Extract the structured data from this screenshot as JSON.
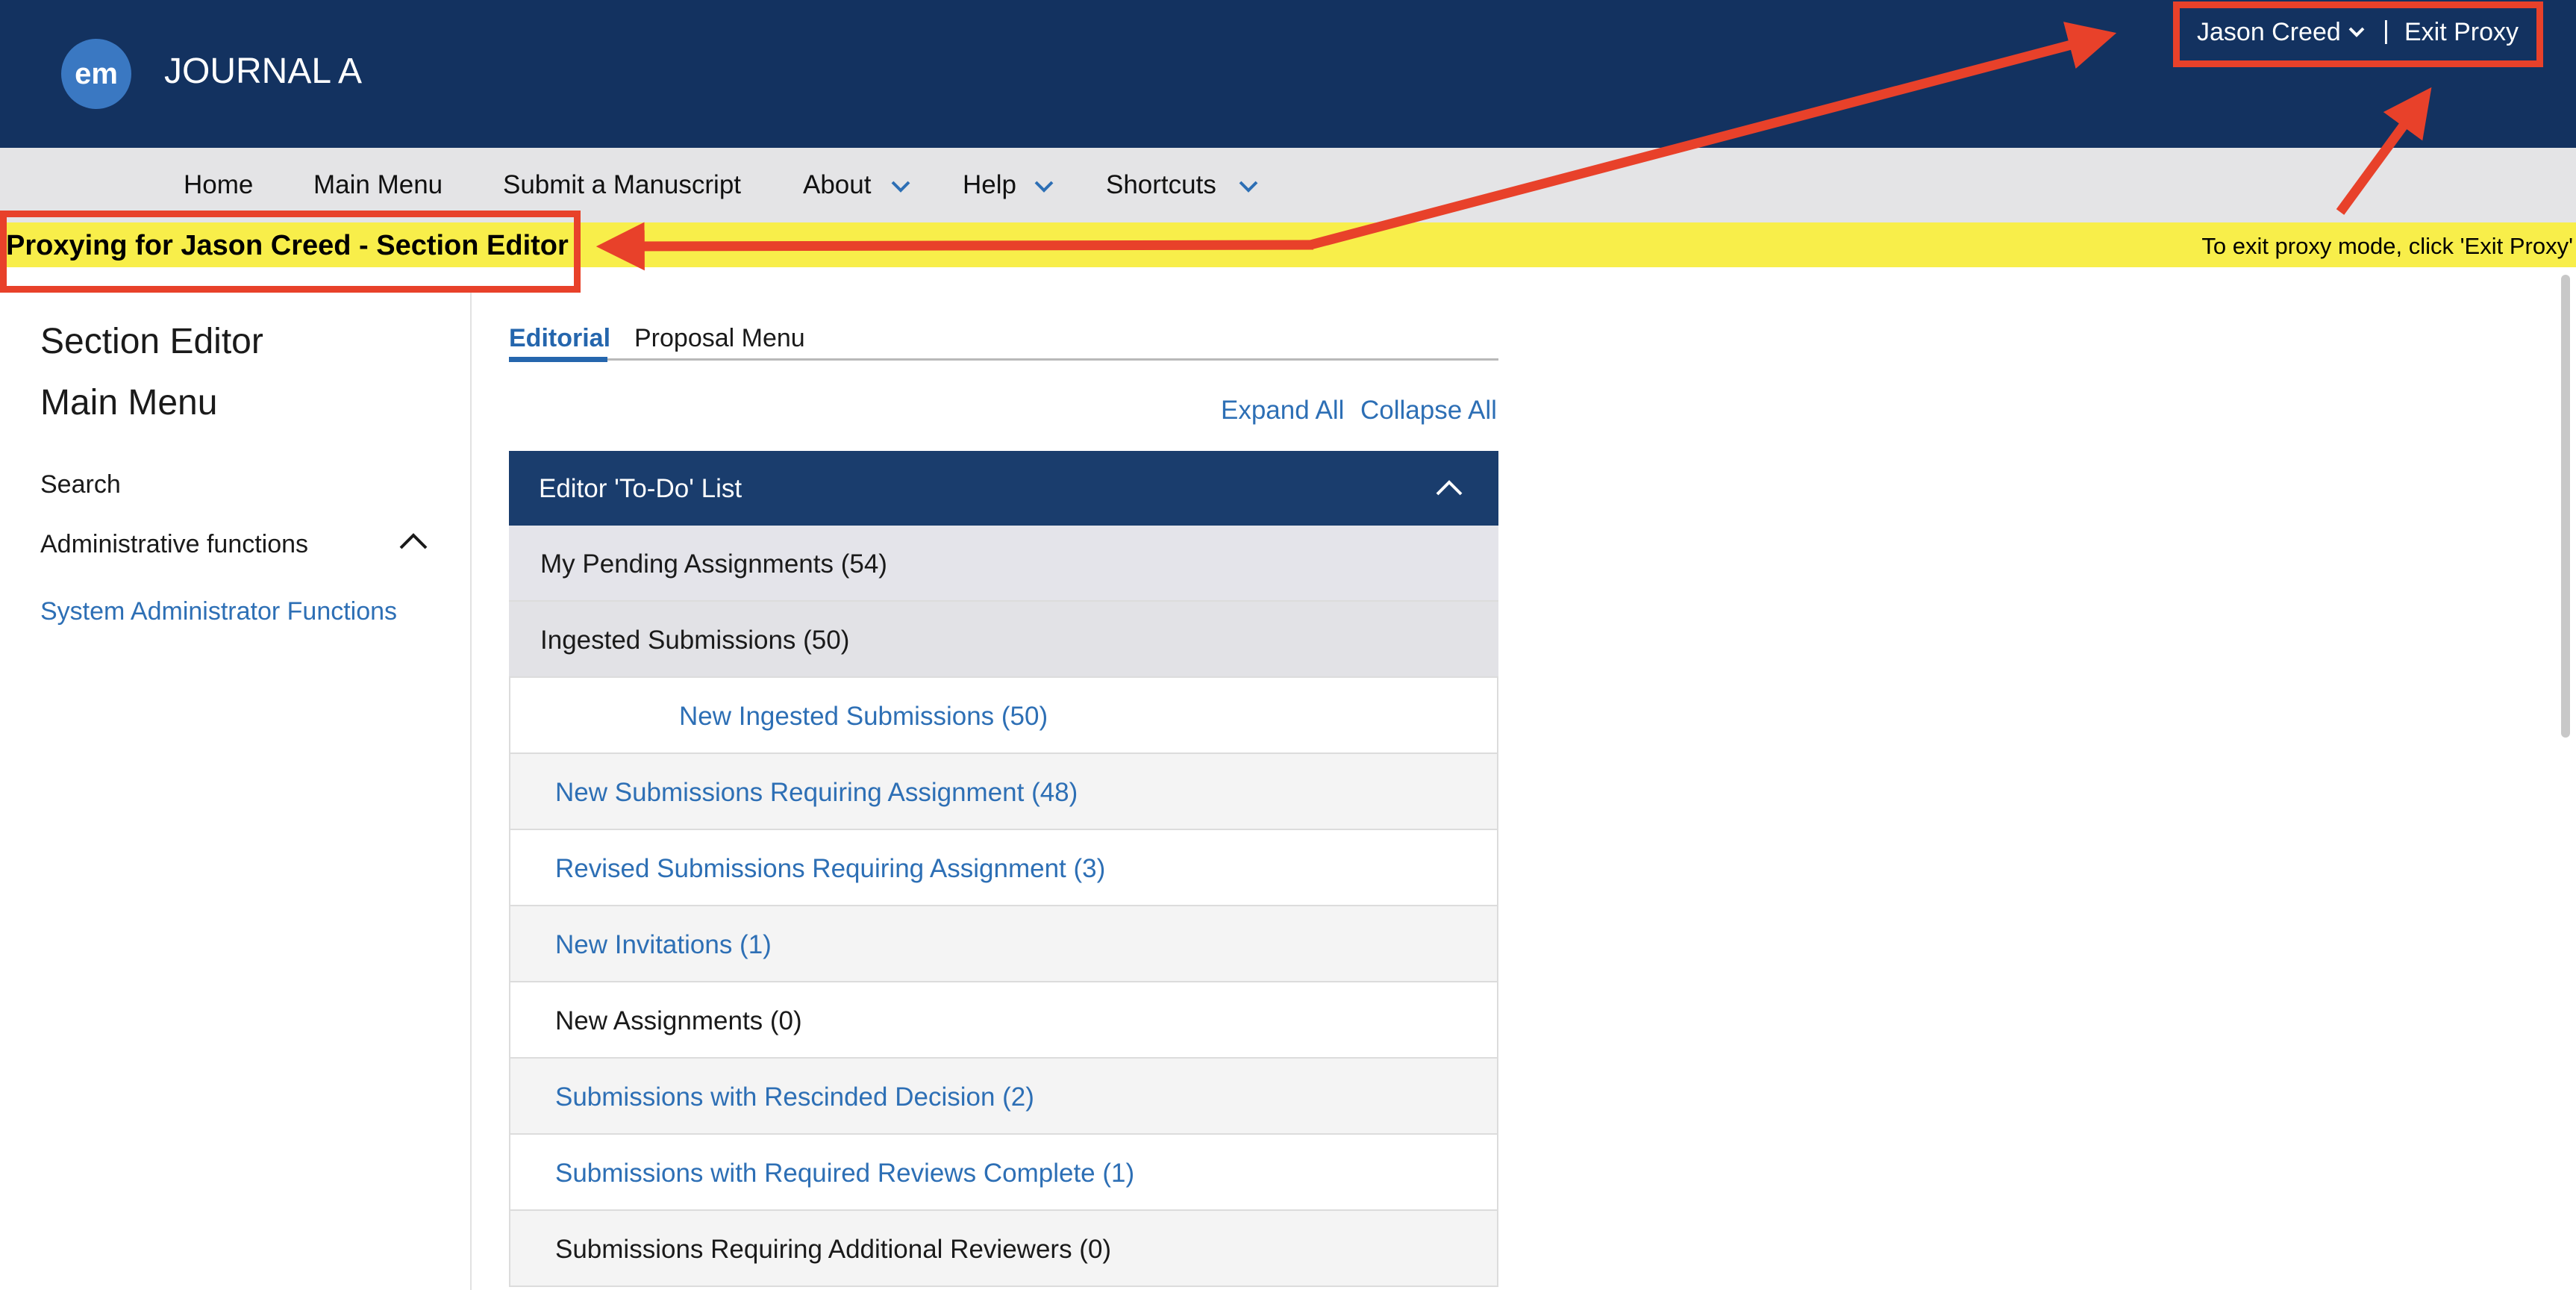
{
  "header": {
    "logo_text": "em",
    "journal_title": "JOURNAL A",
    "user_name": "Jason Creed",
    "separator": "|",
    "exit_proxy": "Exit Proxy",
    "background_color": "#133260"
  },
  "nav": {
    "items": [
      {
        "label": "Home"
      },
      {
        "label": "Main Menu"
      },
      {
        "label": "Submit a Manuscript"
      },
      {
        "label": "About"
      },
      {
        "label": "Help"
      },
      {
        "label": "Shortcuts"
      }
    ]
  },
  "banner": {
    "proxy_text": "Proxying for Jason Creed - Section Editor",
    "exit_hint": "To exit proxy mode, click 'Exit Proxy'",
    "background_color": "#f8ee4a",
    "annotation_color": "#e8412a"
  },
  "sidebar": {
    "title_line1": "Section Editor",
    "title_line2": "Main Menu",
    "search": "Search",
    "admin_functions": "Administrative functions",
    "sysadmin_link": "System Administrator Functions"
  },
  "tabs": {
    "editorial": "Editorial",
    "proposal_menu": "Proposal Menu"
  },
  "actions": {
    "expand_all": "Expand All",
    "collapse_all": "Collapse All"
  },
  "panel": {
    "title": "Editor 'To-Do' List",
    "rows": [
      {
        "label": "My Pending Assignments (54)"
      },
      {
        "label": "Ingested Submissions (50)"
      },
      {
        "label": "New Ingested Submissions (50)"
      },
      {
        "label": "New Submissions Requiring Assignment (48)"
      },
      {
        "label": "Revised Submissions Requiring Assignment (3)"
      },
      {
        "label": "New Invitations (1)"
      },
      {
        "label": "New Assignments (0)"
      },
      {
        "label": "Submissions with Rescinded Decision (2)"
      },
      {
        "label": "Submissions with Required Reviews Complete (1)"
      },
      {
        "label": "Submissions Requiring Additional Reviewers (0)"
      }
    ]
  }
}
